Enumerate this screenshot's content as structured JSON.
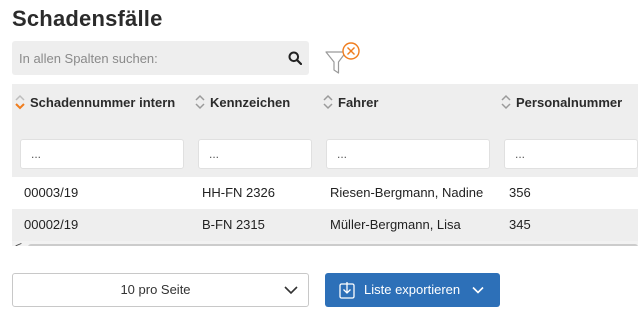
{
  "page": {
    "title": "Schadensfälle"
  },
  "search": {
    "placeholder": "In allen Spalten suchen:",
    "icon": "search-icon"
  },
  "filter_clear": {
    "icon": "filter-clear-icon",
    "accent": "#f07d1e"
  },
  "table": {
    "columns": [
      {
        "label": "Schadennummer intern",
        "filter_placeholder": "...",
        "sort_active": true
      },
      {
        "label": "Kennzeichen",
        "filter_placeholder": "...",
        "sort_active": false
      },
      {
        "label": "Fahrer",
        "filter_placeholder": "...",
        "sort_active": false
      },
      {
        "label": "Personalnummer",
        "filter_placeholder": "...",
        "sort_active": false
      }
    ],
    "rows": [
      [
        "00003/19",
        "HH-FN 2326",
        "Riesen-Bergmann, Nadine",
        "356"
      ],
      [
        "00002/19",
        "B-FN 2315",
        "Müller-Bergmann, Lisa",
        "345"
      ]
    ],
    "scroll_left_label": "<"
  },
  "footer": {
    "page_size": "10 pro Seite",
    "export_label": "Liste exportieren"
  },
  "colors": {
    "primary": "#2d70b8",
    "accent": "#f07d1e",
    "header_bg": "#eeeeee"
  }
}
